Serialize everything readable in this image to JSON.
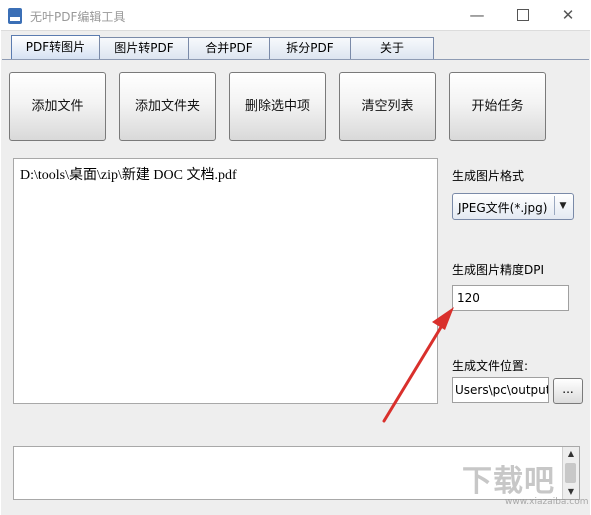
{
  "window": {
    "title": "无叶PDF编辑工具",
    "minimize_icon": "minimize-icon",
    "maximize_icon": "maximize-icon",
    "close_icon": "close-icon"
  },
  "tabs": [
    {
      "label": "PDF转图片",
      "active": true
    },
    {
      "label": "图片转PDF",
      "active": false
    },
    {
      "label": "合并PDF",
      "active": false
    },
    {
      "label": "拆分PDF",
      "active": false
    },
    {
      "label": "关于",
      "active": false
    }
  ],
  "toolbar": {
    "add_file": "添加文件",
    "add_folder": "添加文件夹",
    "delete_selected": "删除选中项",
    "clear_list": "清空列表",
    "start_task": "开始任务"
  },
  "file_list": {
    "items": [
      "D:\\tools\\桌面\\zip\\新建 DOC 文档.pdf"
    ]
  },
  "options": {
    "format_label": "生成图片格式",
    "format_value": "JPEG文件(*.jpg)",
    "dpi_label": "生成图片精度DPI",
    "dpi_value": "120",
    "location_label": "生成文件位置:",
    "location_value": "Users\\pc\\output",
    "browse_label": "..."
  },
  "log": {
    "text": ""
  },
  "watermark": {
    "text": "下载吧",
    "url": "www.xiazaiba.com"
  },
  "colors": {
    "annotation_arrow": "#d9302c"
  }
}
